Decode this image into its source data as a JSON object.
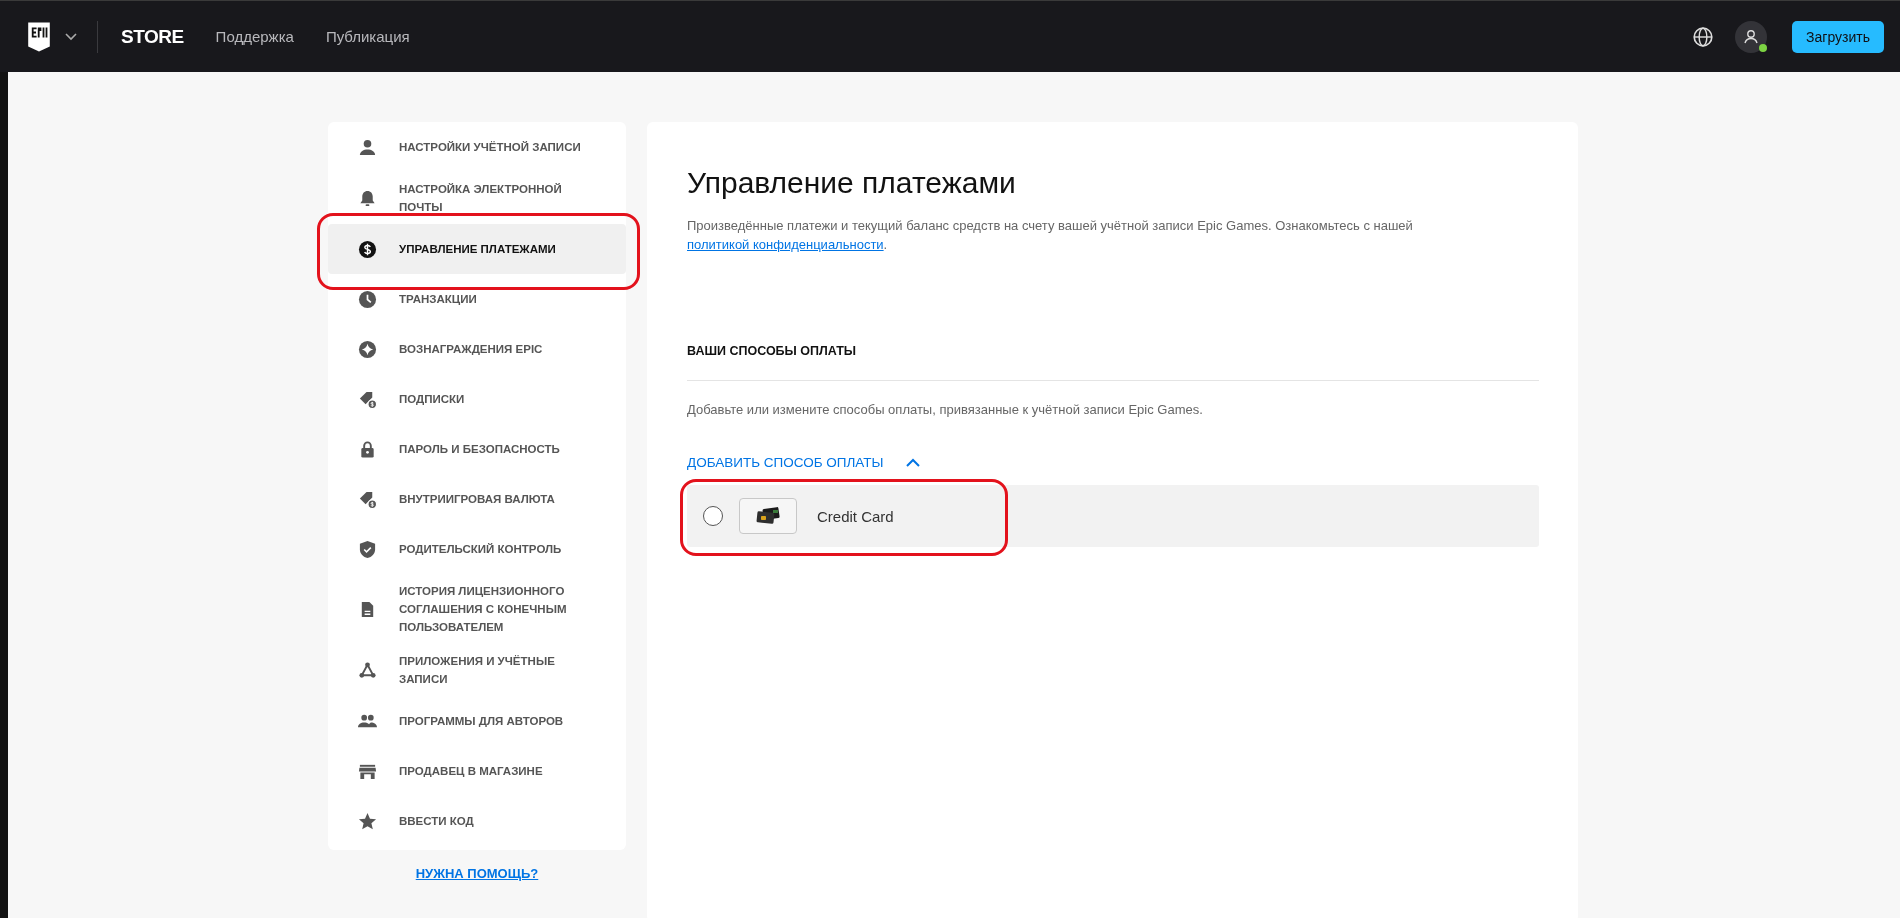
{
  "top_bar": {
    "store_label": "STORE",
    "links": [
      "Поддержка",
      "Публикация"
    ],
    "user_online": true,
    "download_button": "Загрузить"
  },
  "sidebar": {
    "items": [
      {
        "label": "НАСТРОЙКИ УЧЁТНОЙ ЗАПИСИ",
        "selected": false,
        "annotated": false
      },
      {
        "label": "НАСТРОЙКА ЭЛЕКТРОННОЙ ПОЧТЫ",
        "selected": false,
        "annotated": false
      },
      {
        "label": "УПРАВЛЕНИЕ ПЛАТЕЖАМИ",
        "selected": true,
        "annotated": true
      },
      {
        "label": "ТРАНЗАКЦИИ",
        "selected": false,
        "annotated": false
      },
      {
        "label": "ВОЗНАГРАЖДЕНИЯ EPIC",
        "selected": false,
        "annotated": false
      },
      {
        "label": "ПОДПИСКИ",
        "selected": false,
        "annotated": false
      },
      {
        "label": "ПАРОЛЬ И БЕЗОПАСНОСТЬ",
        "selected": false,
        "annotated": false
      },
      {
        "label": "ВНУТРИИГРОВАЯ ВАЛЮТА",
        "selected": false,
        "annotated": false
      },
      {
        "label": "РОДИТЕЛЬСКИЙ КОНТРОЛЬ",
        "selected": false,
        "annotated": false
      },
      {
        "label": "ИСТОРИЯ ЛИЦЕНЗИОННОГО СОГЛАШЕНИЯ С КОНЕЧНЫМ ПОЛЬЗОВАТЕЛЕМ",
        "selected": false,
        "annotated": false
      },
      {
        "label": "ПРИЛОЖЕНИЯ И УЧЁТНЫЕ ЗАПИСИ",
        "selected": false,
        "annotated": false
      },
      {
        "label": "ПРОГРАММЫ ДЛЯ АВТОРОВ",
        "selected": false,
        "annotated": false
      },
      {
        "label": "ПРОДАВЕЦ В МАГАЗИНЕ",
        "selected": false,
        "annotated": false
      },
      {
        "label": "ВВЕСТИ КОД",
        "selected": false,
        "annotated": false
      }
    ],
    "help_link": "НУЖНА ПОМОЩЬ?"
  },
  "main": {
    "title": "Управление платежами",
    "description": "Произведённые платежи и текущий баланс средств на счету вашей учётной записи Epic Games. Ознакомьтесь с нашей ",
    "description_link": "политикой конфиденциальности",
    "description_end": ".",
    "section_title": "ВАШИ СПОСОБЫ ОПЛАТЫ",
    "section_text": "Добавьте или измените способы оплаты, привязанные к учётной записи Epic Games.",
    "add_method": {
      "label": "ДОБАВИТЬ СПОСОБ ОПЛАТЫ",
      "expanded": true
    },
    "payment_methods": [
      {
        "label": "Credit Card",
        "selected": false,
        "annotated": true
      }
    ]
  }
}
